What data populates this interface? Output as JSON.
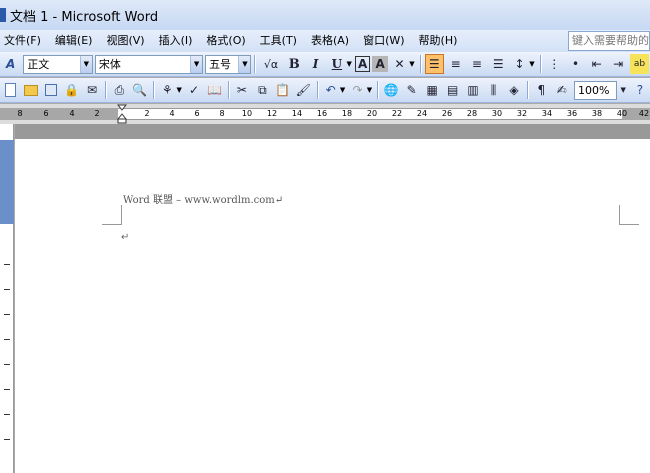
{
  "window": {
    "title": "文档 1 - Microsoft Word"
  },
  "menu": {
    "items": [
      "文件(F)",
      "编辑(E)",
      "视图(V)",
      "插入(I)",
      "格式(O)",
      "工具(T)",
      "表格(A)",
      "窗口(W)",
      "帮助(H)"
    ],
    "help_placeholder": "键入需要帮助的问"
  },
  "formatting": {
    "style": "正文",
    "font": "宋体",
    "size": "五号",
    "bold": "B",
    "italic": "I",
    "underline": "U",
    "char_border": "A",
    "char_shading": "A",
    "insert_formula": "√α"
  },
  "standard": {
    "zoom": "100%"
  },
  "ruler": {
    "ticks": [
      "8",
      "6",
      "4",
      "2",
      "2",
      "4",
      "6",
      "8",
      "10",
      "12",
      "14",
      "16",
      "18",
      "20",
      "22",
      "24",
      "26",
      "28",
      "30",
      "32",
      "34",
      "36",
      "38",
      "40",
      "42"
    ]
  },
  "document": {
    "line1": "Word 联盟 – www.wordlm.com↵",
    "line2": "↵"
  },
  "colors": {
    "title_bar": "#c6d8f3",
    "toolbar": "#c9daf3",
    "active_button": "#ffc06a"
  }
}
